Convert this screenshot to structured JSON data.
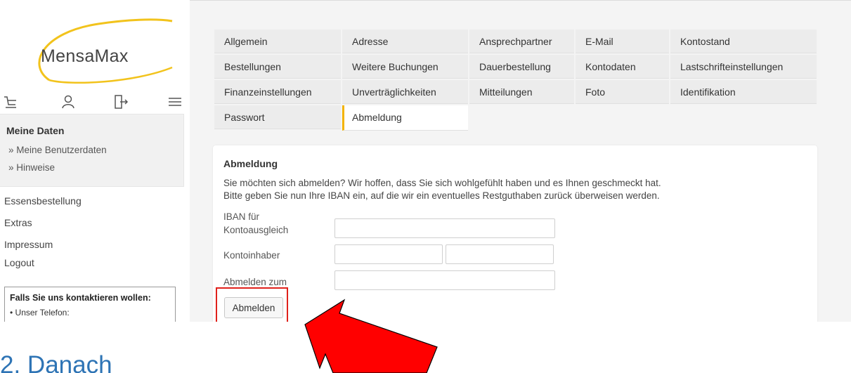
{
  "sidebar": {
    "logo_text": "MensaMax",
    "icons": [
      "cart-icon",
      "user-icon",
      "logout-door-icon",
      "menu-icon"
    ],
    "section_title": "Meine Daten",
    "sub_items": [
      {
        "label": "» Meine Benutzerdaten"
      },
      {
        "label": "» Hinweise"
      }
    ],
    "links": [
      {
        "label": "Essensbestellung"
      },
      {
        "label": "Extras"
      },
      {
        "label": "Impressum"
      },
      {
        "label": "Logout"
      }
    ],
    "contact": {
      "title": "Falls Sie uns kontaktieren wollen:",
      "line": "• Unser Telefon:"
    }
  },
  "tabs": {
    "row1": [
      "Allgemein",
      "Adresse",
      "Ansprechpartner",
      "E-Mail",
      "Kontostand"
    ],
    "row2": [
      "Bestellungen",
      "Weitere Buchungen",
      "Dauerbestellung",
      "Kontodaten",
      "Lastschrifteinstellungen"
    ],
    "row3": [
      "Finanzeinstellungen",
      "Unverträglichkeiten",
      "Mitteilungen",
      "Foto",
      "Identifikation"
    ],
    "row4": [
      "Passwort",
      "Abmeldung"
    ],
    "active": "Abmeldung"
  },
  "form": {
    "title": "Abmeldung",
    "text_line1": "Sie möchten sich abmelden? Wir hoffen, dass Sie sich wohlgefühlt haben und es Ihnen geschmeckt hat.",
    "text_line2": "Bitte geben Sie nun Ihre IBAN ein, auf die wir ein eventuelles Restguthaben zurück überweisen werden.",
    "iban_label_1": "IBAN für",
    "iban_label_2": "Kontoausgleich",
    "iban_value": "",
    "owner_label": "Kontoinhaber",
    "owner_first_value": "",
    "owner_last_value": "",
    "date_label": "Abmelden zum",
    "date_value": "",
    "submit_label": "Abmelden"
  },
  "annotation": {
    "highlight_color": "#e0211b",
    "arrow_color": "#ff0000"
  },
  "below": {
    "partial_heading": "2. Danach"
  }
}
